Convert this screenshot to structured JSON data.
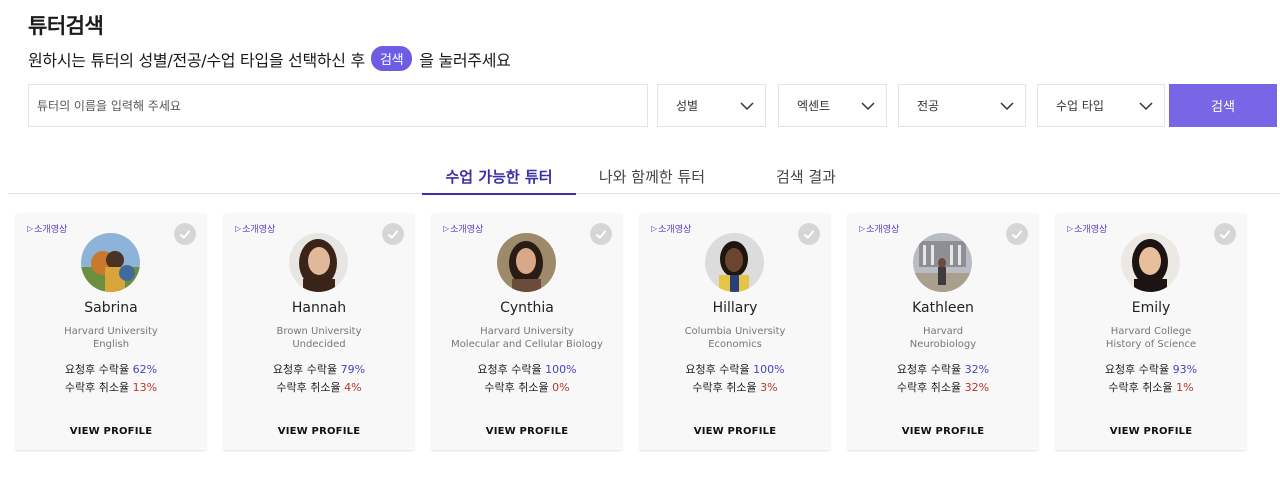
{
  "header": {
    "title": "튜터검색",
    "subtitle_before": "원하시는 튜터의 성별/전공/수업 타입을 선택하신 후",
    "subtitle_pill": "검색",
    "subtitle_after": "을 눌러주세요"
  },
  "search": {
    "placeholder": "튜터의 이름을 입력해 주세요",
    "filters": [
      "성별",
      "엑센트",
      "전공",
      "수업 타입"
    ],
    "button_label": "검색"
  },
  "tabs": [
    {
      "label": "수업 가능한 튜터",
      "active": true
    },
    {
      "label": "나와 함께한 튜터",
      "active": false
    },
    {
      "label": "검색 결과",
      "active": false
    }
  ],
  "card_labels": {
    "intro": "소개영상",
    "accept_rate": "요청후 수락율",
    "cancel_rate": "수락후 취소율",
    "view_profile": "VIEW PROFILE"
  },
  "tutors": [
    {
      "name": "Sabrina",
      "school": "Harvard University",
      "major": "English",
      "accept": "62%",
      "cancel": "13%"
    },
    {
      "name": "Hannah",
      "school": "Brown University",
      "major": "Undecided",
      "accept": "79%",
      "cancel": "4%"
    },
    {
      "name": "Cynthia",
      "school": "Harvard University",
      "major": "Molecular and Cellular Biology",
      "accept": "100%",
      "cancel": "0%"
    },
    {
      "name": "Hillary",
      "school": "Columbia University",
      "major": "Economics",
      "accept": "100%",
      "cancel": "3%"
    },
    {
      "name": "Kathleen",
      "school": "Harvard",
      "major": "Neurobiology",
      "accept": "32%",
      "cancel": "32%"
    },
    {
      "name": "Emily",
      "school": "Harvard College",
      "major": "History of Science",
      "accept": "93%",
      "cancel": "1%"
    }
  ],
  "colors": {
    "accent": "#7766e6",
    "active_tab": "#3b2fa8",
    "accept_value": "#4b3fc4",
    "cancel_value": "#b8342e"
  }
}
